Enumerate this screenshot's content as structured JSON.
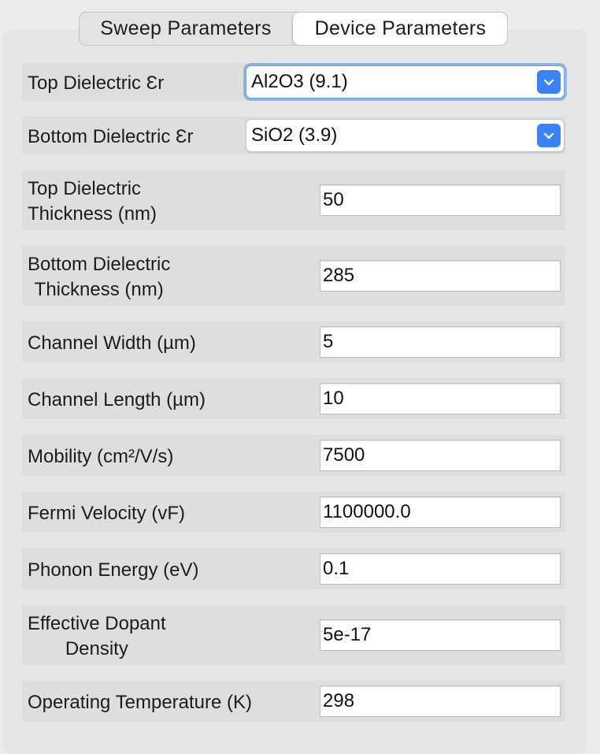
{
  "tabs": [
    {
      "label": "Sweep Parameters",
      "selected": false
    },
    {
      "label": "Device Parameters",
      "selected": true
    }
  ],
  "top_dielectric": {
    "label": "Top Dielectric Ɛr",
    "value": "Al2O3 (9.1)",
    "focused": true
  },
  "bottom_dielectric": {
    "label": "Bottom Dielectric Ɛr",
    "value": "SiO2 (3.9)"
  },
  "top_thickness": {
    "label": " Top Dielectric\nThickness (nm)",
    "value": "50"
  },
  "bottom_thickness": {
    "label": "Bottom Dielectric\nThickness (nm)",
    "value": "285"
  },
  "channel_width": {
    "label": "Channel Width (µm)",
    "value": "5"
  },
  "channel_length": {
    "label": "Channel Length (µm)",
    "value": "10"
  },
  "mobility": {
    "label": "Mobility (cm²/V/s)",
    "value": "7500"
  },
  "fermi_velocity": {
    "label": "Fermi Velocity (vF)",
    "value": "1100000.0"
  },
  "phonon_energy": {
    "label": "Phonon Energy (eV)",
    "value": "0.1"
  },
  "dopant_density": {
    "label": "Effective Dopant\nDensity",
    "value": "5e-17"
  },
  "operating_temp": {
    "label": "Operating Temperature (K)",
    "value": "298"
  },
  "colors": {
    "accent": "#3b82f6",
    "panel": "#e6e6e6",
    "row": "#dedede"
  },
  "icons": {
    "dropdown": "chevron-down-icon"
  }
}
